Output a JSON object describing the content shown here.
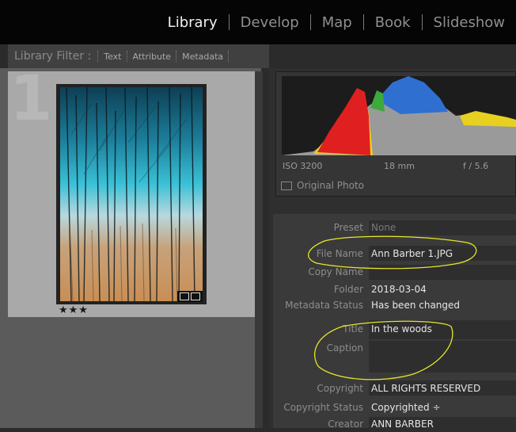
{
  "modules": [
    {
      "label": "Library",
      "active": true
    },
    {
      "label": "Develop",
      "active": false
    },
    {
      "label": "Map",
      "active": false
    },
    {
      "label": "Book",
      "active": false
    },
    {
      "label": "Slideshow",
      "active": false
    }
  ],
  "filter": {
    "label": "Library Filter :",
    "options": [
      "Text",
      "Attribute",
      "Metadata"
    ]
  },
  "grid": {
    "cell_number": "1",
    "rating": "★★★"
  },
  "histogram": {
    "iso": "ISO 3200",
    "focal": "18 mm",
    "aperture": "f / 5.6",
    "original_photo": "Original Photo"
  },
  "metadata": {
    "preset": {
      "label": "Preset",
      "value": "None"
    },
    "file_name": {
      "label": "File Name",
      "value": "Ann Barber 1.JPG"
    },
    "copy_name": {
      "label": "Copy Name",
      "value": ""
    },
    "folder": {
      "label": "Folder",
      "value": "2018-03-04"
    },
    "metadata_status": {
      "label": "Metadata Status",
      "value": "Has been changed"
    },
    "title": {
      "label": "Title",
      "value": "In the woods"
    },
    "caption": {
      "label": "Caption",
      "value": ""
    },
    "copyright": {
      "label": "Copyright",
      "value": "ALL RIGHTS RESERVED"
    },
    "copyright_status": {
      "label": "Copyright Status",
      "value": "Copyrighted ÷"
    },
    "creator": {
      "label": "Creator",
      "value": "ANN BARBER"
    }
  },
  "colors": {
    "annotation": "#e6e62a",
    "histogram_red": "#e02020",
    "histogram_yellow": "#e8d020",
    "histogram_blue": "#2f6fd0",
    "histogram_green": "#3caa3c"
  }
}
